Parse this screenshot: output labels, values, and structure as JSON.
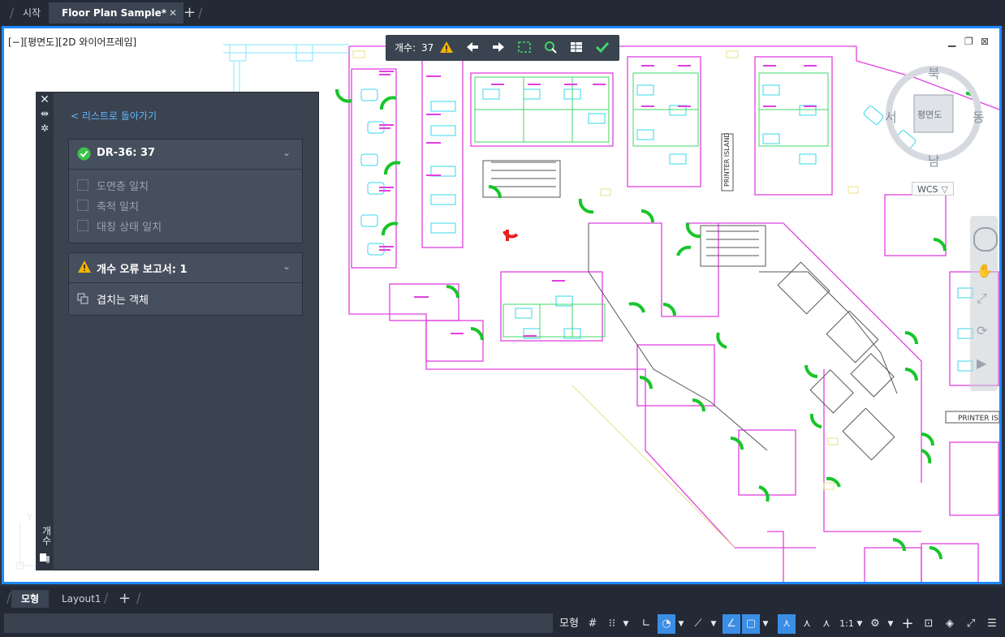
{
  "tabs": {
    "start": "시작",
    "doc": "Floor Plan Sample*",
    "close": "✕",
    "add": "+"
  },
  "viewport": {
    "label": "[−][평면도][2D 와이어프레임]",
    "window_controls": {
      "minimize": "▁",
      "restore": "❐",
      "close": "⊠"
    }
  },
  "count_toolbar": {
    "count_label": "개수:",
    "count_value": "37"
  },
  "palette": {
    "back": "< 리스트로 돌아가기",
    "strip_label": "개수",
    "section1": {
      "title": "DR-36: 37",
      "items": [
        "도면층 일치",
        "축척 일치",
        "대칭 상태 일치"
      ]
    },
    "section2": {
      "title": "개수 오류 보고서: 1",
      "items": [
        "겹치는 객체"
      ]
    }
  },
  "compass": {
    "n": "북",
    "s": "남",
    "w": "서",
    "e": "동",
    "center": "평면도",
    "wcs": "WCS"
  },
  "drawing_labels": {
    "printer1": "PRINTER ISLAND",
    "printer2": "PRINTER ISLA"
  },
  "ucs": {
    "y": "Y"
  },
  "layout_tabs": {
    "model": "모형",
    "layout1": "Layout1",
    "add": "+"
  },
  "statusbar": {
    "model": "모형",
    "scale": "1:1"
  },
  "colors": {
    "accent": "#1e88ff",
    "door_green": "#17c52a",
    "wall_magenta": "#e040e0",
    "furniture_cyan": "#35d8e8",
    "error_red": "#e8201c"
  }
}
